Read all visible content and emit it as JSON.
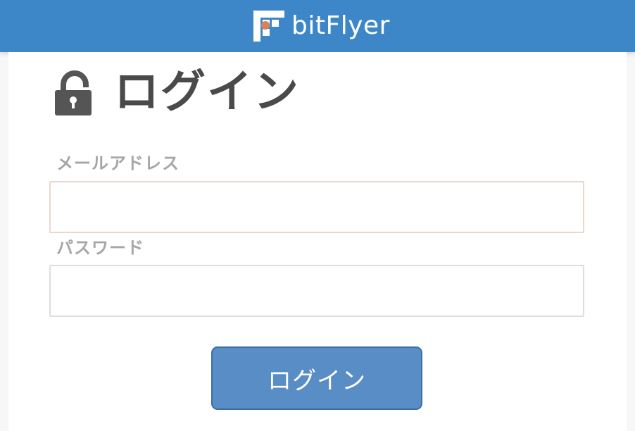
{
  "header": {
    "brand_name": "bitFlyer",
    "logo_icon": "bitflyer-logo-icon",
    "background_color": "#3d86c8",
    "accent_color": "#d9825a"
  },
  "login": {
    "title": "ログイン",
    "title_icon": "lock-icon",
    "email_label": "メールアドレス",
    "email_value": "",
    "password_label": "パスワード",
    "password_value": "",
    "submit_label": "ログイン",
    "button_color": "#588dc5"
  }
}
